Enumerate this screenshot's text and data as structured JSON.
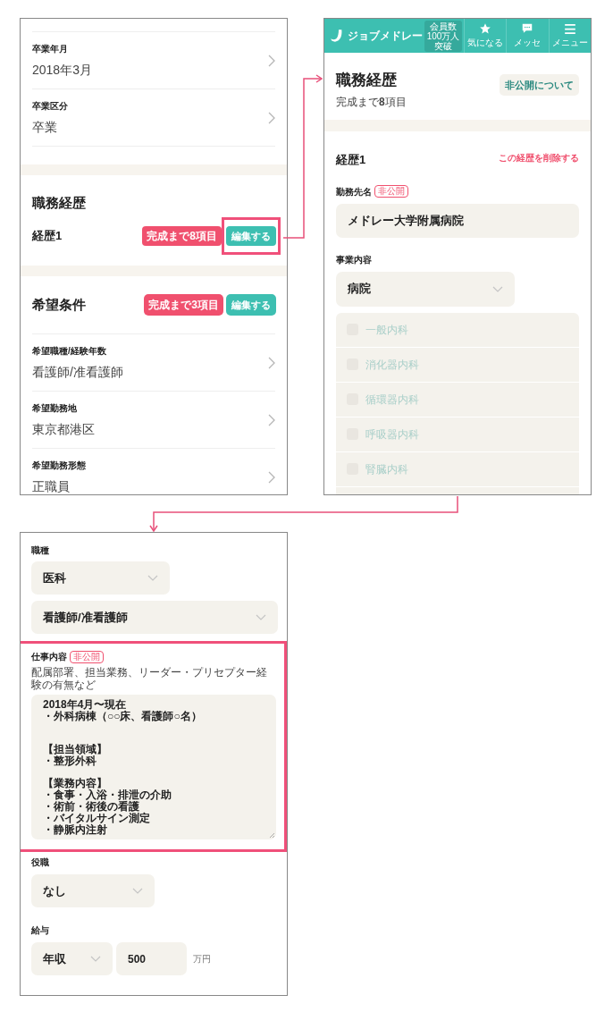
{
  "profile_screen": {
    "education_items": [
      {
        "label": "卒業年月",
        "value": "2018年3月"
      },
      {
        "label": "卒業区分",
        "value": "卒業"
      }
    ],
    "career": {
      "title": "職務経歴",
      "entries": [
        {
          "title": "経歴1",
          "remaining": "完成まで8項目",
          "edit": "編集する"
        }
      ]
    },
    "preferences": {
      "title": "希望条件",
      "remaining": "完成まで3項目",
      "edit": "編集する",
      "items": [
        {
          "label": "希望職種/経験年数",
          "value": "看護師/准看護師"
        },
        {
          "label": "希望勤務地",
          "value": "東京都港区"
        },
        {
          "label": "希望勤務形態",
          "value": "正職員"
        }
      ]
    }
  },
  "career_screen": {
    "header": {
      "logo_text": "ジョブメドレー",
      "badge_lines": [
        "会員数",
        "100万人",
        "突破"
      ],
      "nav": [
        {
          "kind": "star",
          "label": "気になる"
        },
        {
          "kind": "chat",
          "label": "メッセ"
        },
        {
          "kind": "menu",
          "label": "メニュー"
        }
      ]
    },
    "title": "職務経歴",
    "progress": "完成まで**8**項目",
    "about_button": "非公開について",
    "entry_title": "経歴1",
    "delete_link": "この経歴を削除する",
    "employer": {
      "label": "勤務先名",
      "badge": "非公開",
      "value": "メドレー大学附属病院"
    },
    "business": {
      "label": "事業内容",
      "value": "病院",
      "departments": [
        {
          "label": "一般内科",
          "checked": false,
          "disabled": true
        },
        {
          "label": "消化器内科",
          "checked": false,
          "disabled": true
        },
        {
          "label": "循環器内科",
          "checked": false,
          "disabled": true
        },
        {
          "label": "呼吸器内科",
          "checked": false,
          "disabled": true
        },
        {
          "label": "腎臓内科",
          "checked": false,
          "disabled": true
        }
      ]
    }
  },
  "job_detail_screen": {
    "occupation": {
      "label": "職種",
      "values": [
        "医科",
        "看護師/准看護師"
      ]
    },
    "duties": {
      "label": "仕事内容",
      "badge": "非公開",
      "hint": "配属部署、担当業務、リーダー・プリセプター経験の有無など",
      "paragraphs": [
        [
          "2018年4月〜現在",
          "・外科病棟（○○床、看護師○名）"
        ],
        [
          "【担当領域】",
          "・整形外科"
        ],
        [
          "【業務内容】",
          "・食事・入浴・排泄の介助",
          "・術前・術後の看護",
          "・バイタルサイン測定",
          "・静脈内注射"
        ]
      ]
    },
    "position": {
      "label": "役職",
      "value": "なし"
    },
    "salary": {
      "label": "給与",
      "period": "年収",
      "amount": "500",
      "unit": "万円"
    }
  }
}
